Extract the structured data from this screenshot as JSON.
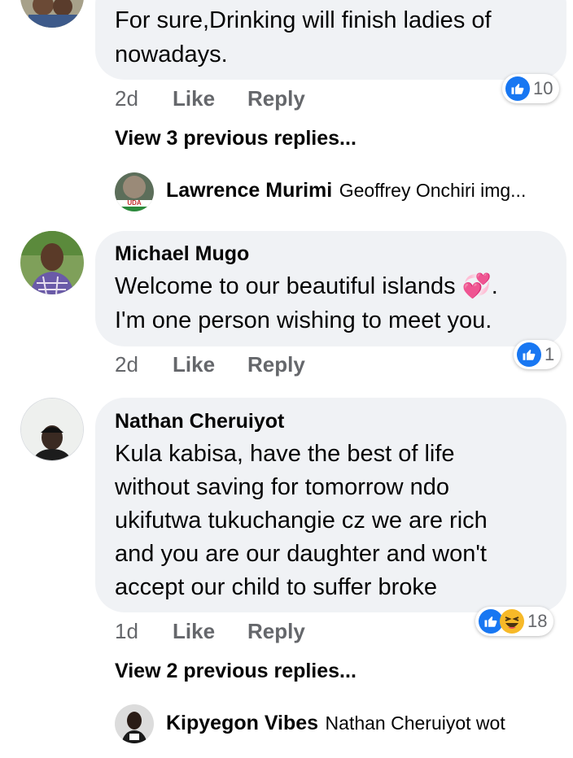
{
  "comments": [
    {
      "text_lines": [
        "For sure,Drinking will finish ladies of",
        "nowadays."
      ],
      "time": "2d",
      "like_label": "Like",
      "reply_label": "Reply",
      "reaction_count": "10"
    },
    {
      "author": "Michael Mugo",
      "text_lines": [
        "Welcome to our beautiful islands 💞.",
        "I'm one person wishing to meet you."
      ],
      "time": "2d",
      "like_label": "Like",
      "reply_label": "Reply",
      "reaction_count": "1"
    },
    {
      "author": "Nathan Cheruiyot",
      "text_lines": [
        "Kula kabisa, have the best of life",
        "without saving for tomorrow ndo",
        "ukifutwa tukuchangie cz we are rich",
        "and you are our daughter and won't",
        "accept our child to suffer broke"
      ],
      "time": "1d",
      "like_label": "Like",
      "reply_label": "Reply",
      "reaction_count": "18"
    }
  ],
  "view_previous_1": "View 3 previous replies...",
  "reply_preview_1": {
    "author": "Lawrence Murimi",
    "text": "Geoffrey Onchiri img...",
    "avatar_badge": "UDA"
  },
  "view_previous_2": "View 2 previous replies...",
  "reply_preview_2": {
    "author": "Kipyegon Vibes",
    "text": "Nathan Cheruiyot wot"
  },
  "colors": {
    "bubble": "#f0f2f5",
    "meta": "#65676b",
    "like_blue": "#1877f2",
    "haha_yellow": "#f7b928"
  }
}
